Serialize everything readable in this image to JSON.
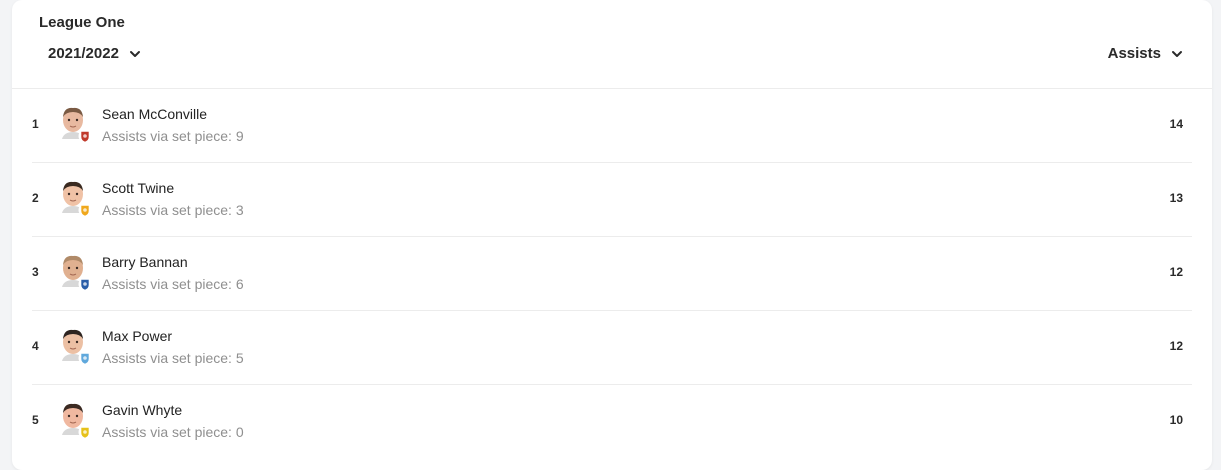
{
  "header": {
    "league": "League One",
    "season": "2021/2022",
    "stat": "Assists"
  },
  "players": [
    {
      "rank": "1",
      "name": "Sean McConville",
      "sub": "Assists via set piece: 9",
      "value": "14",
      "club_color": "#c0392b",
      "skin": "#e8b9a0",
      "hair": "#7a5a43"
    },
    {
      "rank": "2",
      "name": "Scott Twine",
      "sub": "Assists via set piece: 3",
      "value": "13",
      "club_color": "#f0a81c",
      "skin": "#f0c2a6",
      "hair": "#3a2a20"
    },
    {
      "rank": "3",
      "name": "Barry Bannan",
      "sub": "Assists via set piece: 6",
      "value": "12",
      "club_color": "#2a5ea8",
      "skin": "#e0b090",
      "hair": "#b08a68"
    },
    {
      "rank": "4",
      "name": "Max Power",
      "sub": "Assists via set piece: 5",
      "value": "12",
      "club_color": "#5fa8dc",
      "skin": "#ecc0a4",
      "hair": "#2d2420"
    },
    {
      "rank": "5",
      "name": "Gavin Whyte",
      "sub": "Assists via set piece: 0",
      "value": "10",
      "club_color": "#e6c11a",
      "skin": "#f0b8a0",
      "hair": "#3b2a22"
    }
  ],
  "icons": {
    "season_chevron": "chevron-down-icon",
    "stat_chevron": "chevron-down-icon"
  }
}
